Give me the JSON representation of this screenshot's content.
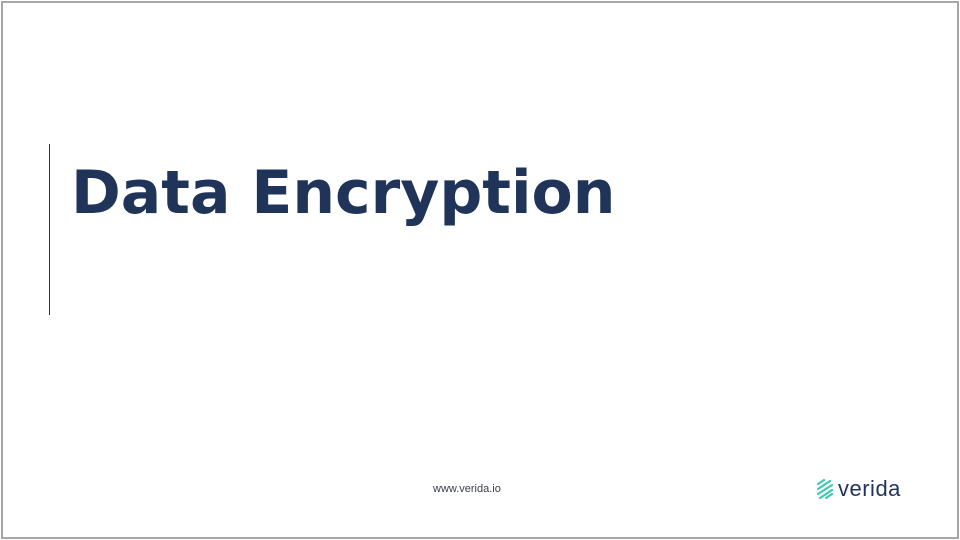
{
  "slide": {
    "title": "Data Encryption",
    "footer_url": "www.verida.io",
    "logo": {
      "icon": "verida-logo-icon",
      "text": "verida",
      "icon_color": "#3ec9b0",
      "text_color": "#1f3458"
    },
    "colors": {
      "title": "#1f3458",
      "accent_line": "#1f3458",
      "border": "#a6a6a6",
      "background": "#ffffff"
    }
  }
}
